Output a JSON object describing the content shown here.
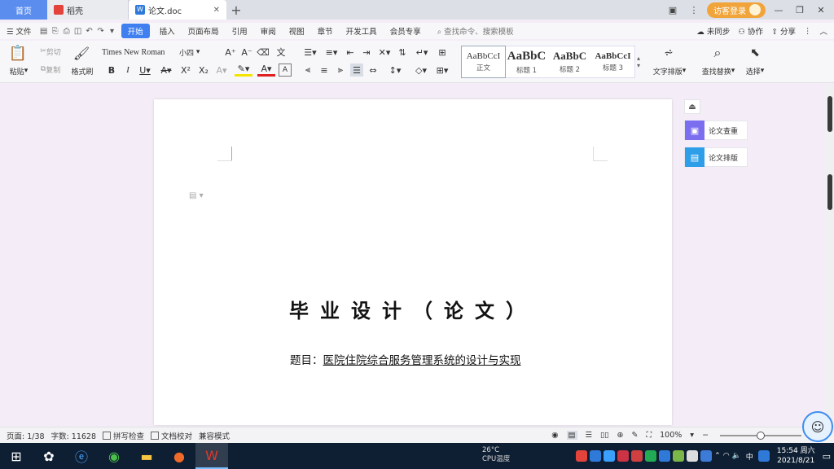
{
  "titlebar": {
    "tabs": [
      {
        "label": "首页"
      },
      {
        "label": "稻壳"
      },
      {
        "label": "论文.doc"
      }
    ],
    "login_label": "访客登录"
  },
  "menubar": {
    "file": "文件",
    "items": [
      "开始",
      "插入",
      "页面布局",
      "引用",
      "审阅",
      "视图",
      "章节",
      "开发工具",
      "会员专享"
    ],
    "search_placeholder": "查找命令、搜索模板",
    "sync": "未同步",
    "collab": "协作",
    "share": "分享"
  },
  "ribbon": {
    "paste": "粘贴",
    "cut": "剪切",
    "copy": "复制",
    "format_painter": "格式刷",
    "font_name": "Times New Roman",
    "font_size": "小四",
    "styles": [
      {
        "sample": "AaBbCcI",
        "name": "正文"
      },
      {
        "sample": "AaBbC",
        "name": "标题 1"
      },
      {
        "sample": "AaBbC",
        "name": "标题 2"
      },
      {
        "sample": "AaBbCcI",
        "name": "标题 3"
      }
    ],
    "text_layout": "文字排版",
    "find_replace": "查找替换",
    "select": "选择"
  },
  "document": {
    "title": "毕业设计（论文）",
    "subject_label": "题目：",
    "subject": "医院住院综合服务管理系统的设计与实现"
  },
  "side_panels": [
    {
      "label": "论文查重",
      "color": "#7b6ff0"
    },
    {
      "label": "论文排版",
      "color": "#2f9ee8"
    }
  ],
  "statusbar": {
    "page": "页面: 1/38",
    "words": "字数: 11628",
    "spell_check": "拼写检查",
    "doc_proof": "文档校对",
    "compat_mode": "兼容模式",
    "zoom": "100%",
    "zoom_level": 0.5
  },
  "taskbar": {
    "weather_temp": "26°C",
    "weather_label": "CPU温度",
    "ime": "中",
    "time": "15:54 周六",
    "date": "2021/8/21"
  }
}
